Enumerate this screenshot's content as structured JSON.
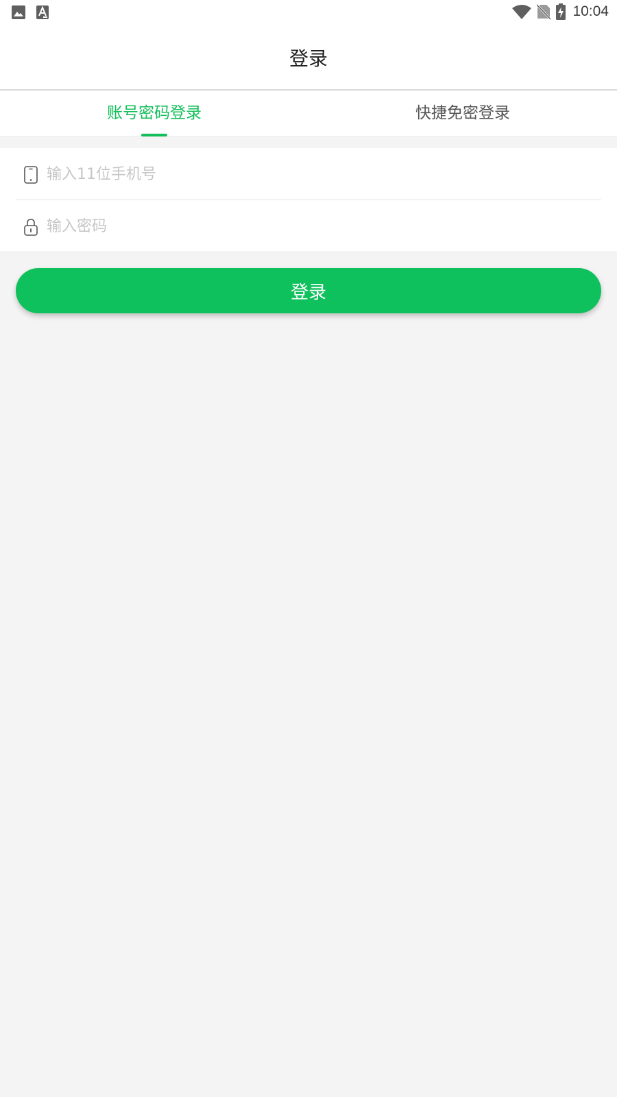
{
  "status_bar": {
    "time": "10:04",
    "left_icons": [
      "image-icon",
      "font-a-icon"
    ],
    "right_icons": [
      "wifi-icon",
      "no-sim-icon",
      "battery-charging-icon"
    ]
  },
  "header": {
    "title": "登录"
  },
  "tabs": [
    {
      "label": "账号密码登录",
      "active": true
    },
    {
      "label": "快捷免密登录",
      "active": false
    }
  ],
  "form": {
    "phone": {
      "placeholder": "输入11位手机号",
      "value": "",
      "icon": "phone-icon"
    },
    "password": {
      "placeholder": "输入密码",
      "value": "",
      "icon": "lock-icon"
    }
  },
  "login_button": {
    "label": "登录"
  },
  "colors": {
    "accent": "#12be5a",
    "button": "#0fc15c",
    "background": "#f4f4f4",
    "placeholder": "#c6c6c6"
  }
}
